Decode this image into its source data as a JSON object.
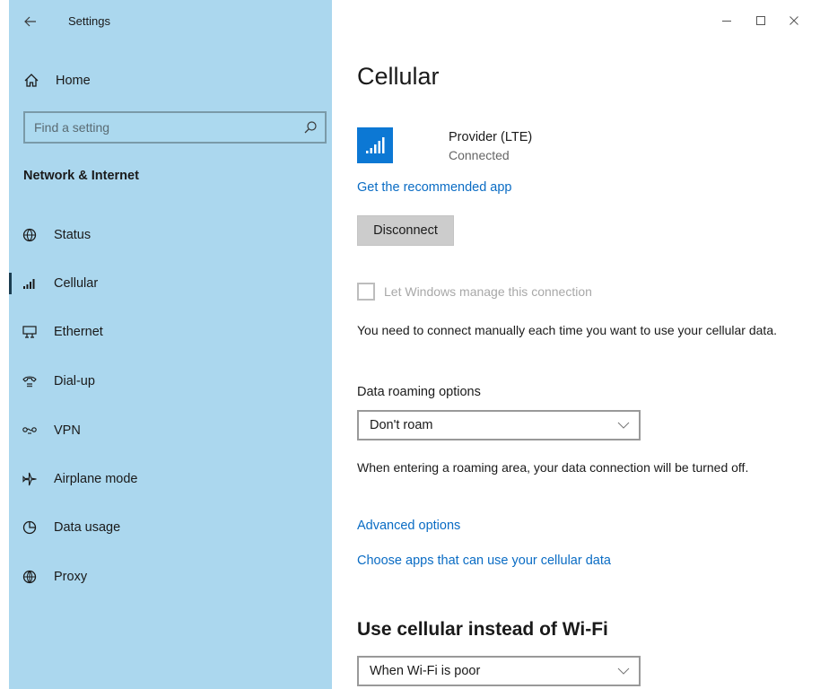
{
  "app": {
    "title": "Settings"
  },
  "sidebar": {
    "home_label": "Home",
    "search": {
      "placeholder": "Find a setting",
      "value": ""
    },
    "section_title": "Network & Internet",
    "items": [
      {
        "label": "Status",
        "icon": "status-globe-icon",
        "selected": false
      },
      {
        "label": "Cellular",
        "icon": "cellular-signal-icon",
        "selected": true
      },
      {
        "label": "Ethernet",
        "icon": "ethernet-icon",
        "selected": false
      },
      {
        "label": "Dial-up",
        "icon": "dial-up-icon",
        "selected": false
      },
      {
        "label": "VPN",
        "icon": "vpn-icon",
        "selected": false
      },
      {
        "label": "Airplane mode",
        "icon": "airplane-icon",
        "selected": false
      },
      {
        "label": "Data usage",
        "icon": "data-usage-icon",
        "selected": false
      },
      {
        "label": "Proxy",
        "icon": "proxy-globe-icon",
        "selected": false
      }
    ]
  },
  "main": {
    "title": "Cellular",
    "provider": {
      "name": "Provider (LTE)",
      "status": "Connected"
    },
    "recommended_link": "Get the recommended app",
    "disconnect_label": "Disconnect",
    "manage_checkbox": {
      "label": "Let Windows manage this connection",
      "checked": false,
      "enabled": false
    },
    "manual_note": "You need to connect manually each time you want to use your cellular data.",
    "roaming": {
      "label": "Data roaming options",
      "selected": "Don't roam",
      "note": "When entering a roaming area, your data connection will be turned off."
    },
    "advanced_link": "Advanced options",
    "choose_apps_link": "Choose apps that can use your cellular data",
    "wifi_section": {
      "title": "Use cellular instead of Wi-Fi",
      "selected": "When Wi-Fi is poor"
    }
  },
  "colors": {
    "sidebar_bg": "#abd7ee",
    "accent": "#0c78d4",
    "link": "#0a6cc4"
  }
}
